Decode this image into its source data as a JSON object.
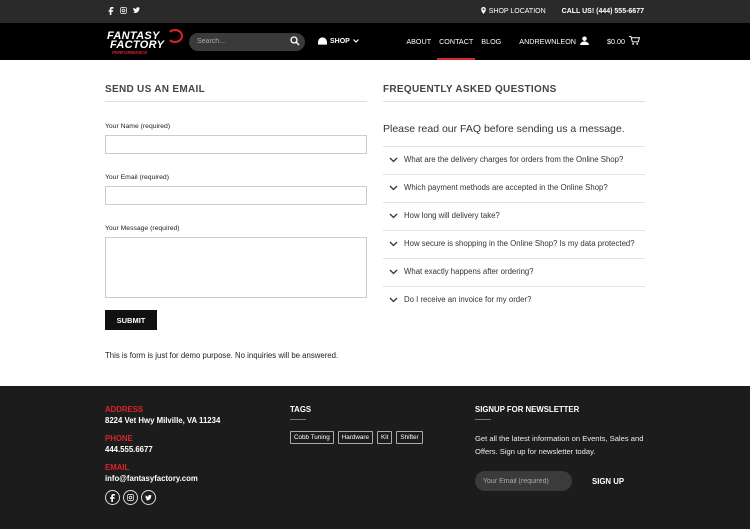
{
  "topbar": {
    "location": "SHOP LOCATION",
    "call": "CALL US! (444) 555-6677"
  },
  "header": {
    "logo_line1": "FANTASY",
    "logo_line2": "FACTORY",
    "logo_line3": "PERFORMANCE",
    "search_placeholder": "Search...",
    "shop_label": "SHOP",
    "nav": [
      "ABOUT",
      "CONTACT",
      "BLOG"
    ],
    "user": "ANDREWNLEON",
    "cart": "$0.00",
    "accent": "#d7262c"
  },
  "email_section": {
    "heading": "SEND US AN EMAIL",
    "name_label": "Your Name (required)",
    "email_label": "Your Email (required)",
    "message_label": "Your Message (required)",
    "submit": "SUBMIT",
    "note": "This is form is just for demo purpose. No inquiries will be answered."
  },
  "faq": {
    "heading": "FREQUENTLY ASKED QUESTIONS",
    "intro": "Please read our FAQ before sending us a message.",
    "items": [
      "What are the delivery charges for orders from the Online Shop?",
      "Which payment methods are accepted in the Online Shop?",
      "How long will delivery take?",
      "How secure is shopping in the Online Shop? Is my data protected?",
      "What exactly happens after ordering?",
      "Do I receive an invoice for my order?"
    ]
  },
  "footer": {
    "address_label": "ADDRESS",
    "address": "8224 Vet Hwy Milville, VA 11234",
    "phone_label": "PHONE",
    "phone": "444.555.6677",
    "email_label": "EMAIL",
    "email": "info@fantasyfactory.com",
    "tags_heading": "TAGS",
    "tags": [
      "Cobb Tuning",
      "Hardware",
      "Kit",
      "Shifter"
    ],
    "newsletter_heading": "SIGNUP FOR NEWSLETTER",
    "newsletter_text": "Get all the latest information on Events, Sales and Offers. Sign up for newsletter today.",
    "newsletter_placeholder": "Your Email (required)",
    "signup": "SIGN UP"
  }
}
